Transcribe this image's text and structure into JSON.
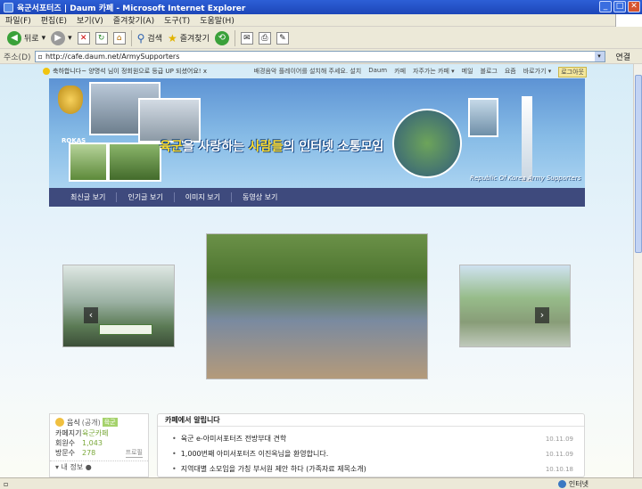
{
  "window": {
    "title": "육군서포터즈 | Daum 카페 - Microsoft Internet Explorer",
    "controls": [
      "_",
      "□",
      "✕"
    ]
  },
  "menu": [
    "파일(F)",
    "편집(E)",
    "보기(V)",
    "즐겨찾기(A)",
    "도구(T)",
    "도움말(H)"
  ],
  "toolbar": {
    "back": "뒤로",
    "search": "검색",
    "favorites": "즐겨찾기"
  },
  "address": {
    "label": "주소(D)",
    "url": "http://cafe.daum.net/ArmySupporters",
    "go": "연결"
  },
  "notification": "축하합니다~ 양명석 님이 정회원으로 등급 UP 되셨어요! x",
  "util_links": [
    "배경음악 플레이어를 설치해 주세요. 설치",
    "Daum",
    "카페",
    "자주가는 카페 ▾",
    "메일",
    "블로그",
    "요즘",
    "바로가기 ▾",
    "로그아웃"
  ],
  "banner": {
    "roka": "ROKAS",
    "slogan_prefix": "육군",
    "slogan_mid": "을 사랑하는 ",
    "slogan_people": "사람들",
    "slogan_suffix": "의 인터넷 소통모임",
    "rokas": "Republic Of Korea Army Supporters",
    "sign": "아미서포터즈"
  },
  "nav": [
    "최신글 보기",
    "인기글 보기",
    "이미지 보기",
    "동영상 보기"
  ],
  "gallery": {
    "prev": "‹",
    "next": "›"
  },
  "cafe_info": {
    "name_label": "음식",
    "visibility": "(공개)",
    "tag": "육군",
    "rows": [
      {
        "k": "카페지기",
        "v": "육군카페"
      },
      {
        "k": "회원수",
        "v": "1,043"
      },
      {
        "k": "방문수",
        "v": "278"
      }
    ],
    "profile": "프로필",
    "more": "▾ 내 정보 ●"
  },
  "notices": {
    "title": "카페에서 알립니다",
    "items": [
      {
        "t": "육군 e-아미서포터즈 전방부대 견학",
        "d": "10.11.09"
      },
      {
        "t": "1,000번째 아미서포터즈 이진옥님을 환영합니다.",
        "d": "10.11.09"
      },
      {
        "t": "지역대별 소모임을 가칭 부서원 제안 하다 (가족자료 제목소개)",
        "d": "10.10.18"
      }
    ]
  },
  "status": {
    "zone": "인터넷"
  }
}
